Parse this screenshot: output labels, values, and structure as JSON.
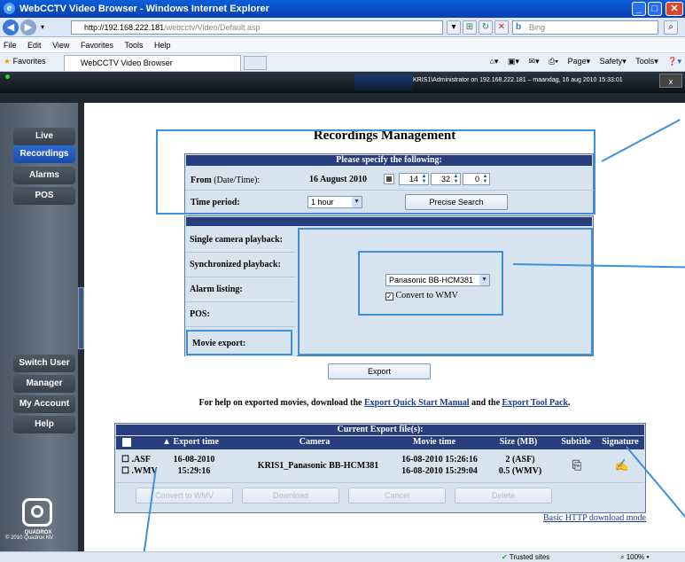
{
  "window": {
    "title": "WebCCTV Video Browser - Windows Internet Explorer"
  },
  "browser": {
    "url_host": "http://192.168.222.181",
    "url_path": "/webcctv/Video/Default.asp",
    "search_placeholder": "Bing",
    "menu": [
      "File",
      "Edit",
      "View",
      "Favorites",
      "Tools",
      "Help"
    ],
    "favorites_label": "Favorites",
    "tab_title": "WebCCTV Video Browser",
    "toolbar": [
      "Page",
      "Safety",
      "Tools"
    ]
  },
  "app": {
    "session_info": "KRIS1\\Administrator on 192.168.222.181 – maandag, 16 aug 2010 15:33:01",
    "close_label": "x",
    "nav_top": [
      "Live",
      "Recordings",
      "Alarms",
      "POS"
    ],
    "nav_active": "Recordings",
    "nav_bottom": [
      "Switch User",
      "Manager",
      "My Account",
      "Help"
    ],
    "logo_text": "QUADROX",
    "copyright": "© 2010 Quadrox NV"
  },
  "page": {
    "heading": "Recordings Management",
    "form": {
      "header": "Please specify the following:",
      "from_label_bold": "From",
      "from_label_rest": " (Date/Time):",
      "date": "16 August 2010",
      "hour": "14",
      "minute": "32",
      "second": "0",
      "period_label": "Time period:",
      "period_value": "1 hour",
      "precise_search": "Precise Search"
    },
    "modes": [
      "Single camera playback:",
      "Synchronized playback:",
      "Alarm listing:",
      "POS:",
      "Movie export:"
    ],
    "selected_mode": "Movie export:",
    "camera_select": "Panasonic BB-HCM381",
    "convert_label": "Convert to WMV",
    "convert_checked": true,
    "export_button": "Export",
    "help_prefix": "For help on exported movies, download the ",
    "help_link1": "Export Quick Start Manual",
    "help_mid": " and the ",
    "help_link2": "Export Tool Pack",
    "help_suffix": ".",
    "exports": {
      "title": "Current Export file(s):",
      "columns": [
        "Export time",
        "Camera",
        "Movie time",
        "Size (MB)",
        "Subtitle",
        "Signature"
      ],
      "sort_indicator": "▲",
      "rows": [
        {
          "formats": [
            ".ASF",
            ".WMV"
          ],
          "export_time": [
            "16-08-2010",
            "15:29:16"
          ],
          "camera": "KRIS1_Panasonic BB-HCM381",
          "movie_time": [
            "16-08-2010 15:26:16",
            "16-08-2010 15:29:04"
          ],
          "size": [
            "2 (ASF)",
            "0.5 (WMV)"
          ]
        }
      ],
      "buttons": [
        "Convert to WMV",
        "Download",
        "Cancel",
        "Delete"
      ],
      "basic_link": "Basic HTTP download mode"
    }
  },
  "statusbar": {
    "zone": "Trusted sites",
    "zoom": "100%"
  },
  "colors": {
    "accent": "#273d7d",
    "callout": "#3d8fe0",
    "panel": "#d7e4ef",
    "nav_active": "#2d6cd4"
  }
}
